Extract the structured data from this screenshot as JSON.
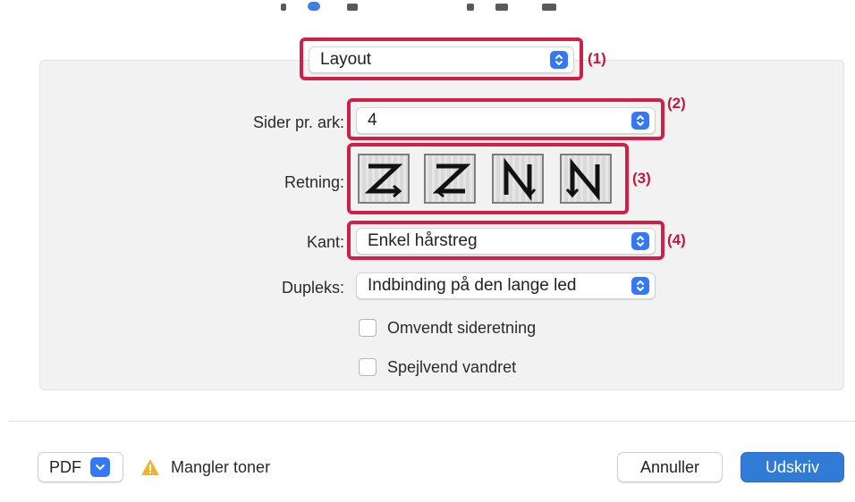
{
  "panel_selector": {
    "value": "Layout",
    "callout": "(1)"
  },
  "layout": {
    "sider_pr_ark": {
      "label": "Sider pr. ark:",
      "value": "4",
      "callout": "(2)"
    },
    "retning": {
      "label": "Retning:",
      "callout": "(3)",
      "options": [
        "z-shape-direction-icon",
        "reverse-z-shape-direction-icon",
        "reverse-n-shape-direction-icon",
        "n-shape-direction-icon"
      ]
    },
    "kant": {
      "label": "Kant:",
      "value": "Enkel hårstreg",
      "callout": "(4)"
    },
    "dupleks": {
      "label": "Dupleks:",
      "value": "Indbinding på den lange led"
    },
    "checkboxes": [
      {
        "label": "Omvendt sideretning",
        "checked": false
      },
      {
        "label": "Spejlvend vandret",
        "checked": false
      }
    ]
  },
  "footer": {
    "pdf_label": "PDF",
    "warning_text": "Mangler toner",
    "cancel_label": "Annuller",
    "print_label": "Udskriv"
  },
  "colors": {
    "highlight": "#d11f4a",
    "accent": "#3478f6",
    "primary_button": "#2f7bd6",
    "warning": "#f0b429"
  }
}
